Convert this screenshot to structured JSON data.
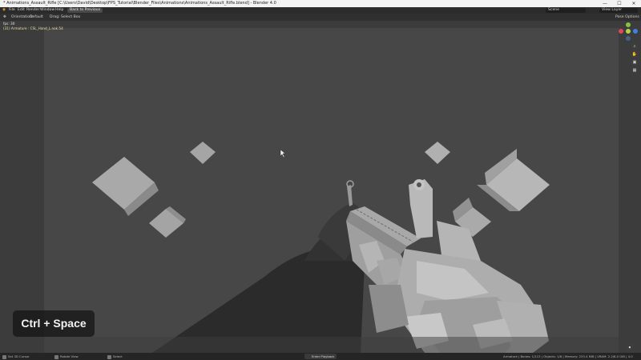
{
  "window": {
    "title": "* Animations_Assault_Rifle [C:\\Users\\David\\Desktop\\FPS_Tutorial\\Blender_Files\\Animations\\Animations_Assault_Rifle.blend] - Blender 4.0",
    "minimize": "—",
    "maximize": "☐",
    "close": "✕"
  },
  "menu": {
    "items": [
      "File",
      "Edit",
      "Render",
      "Window",
      "Help"
    ],
    "back_button": "Back to Previous",
    "scene": "Scene",
    "view_layer": "View Layer"
  },
  "viewport_header": {
    "orientation_label": "Orientation:",
    "orientation_value": "Default",
    "drag_label": "Drag:",
    "drag_value": "Select Box",
    "pose_options": "Pose Options"
  },
  "overlay": {
    "fps": "fps: 30",
    "context": "(31) Armature : CSL_Hand_L.nok.54"
  },
  "key_badge": "Ctrl + Space",
  "status": {
    "left": [
      "Set 3D Cursor",
      "Rotate View",
      "Select"
    ],
    "center": "Enter Playback",
    "right": "Armature | Bones: 1/113 | Objects: 1/8 | Memory: 233.4 MiB | VRAM: 2.2/8.0 GiB | 4.0"
  },
  "gizmo": {
    "x_color": "#e0475b",
    "y_color": "#8ac23f",
    "z_color": "#3f7fe0"
  }
}
